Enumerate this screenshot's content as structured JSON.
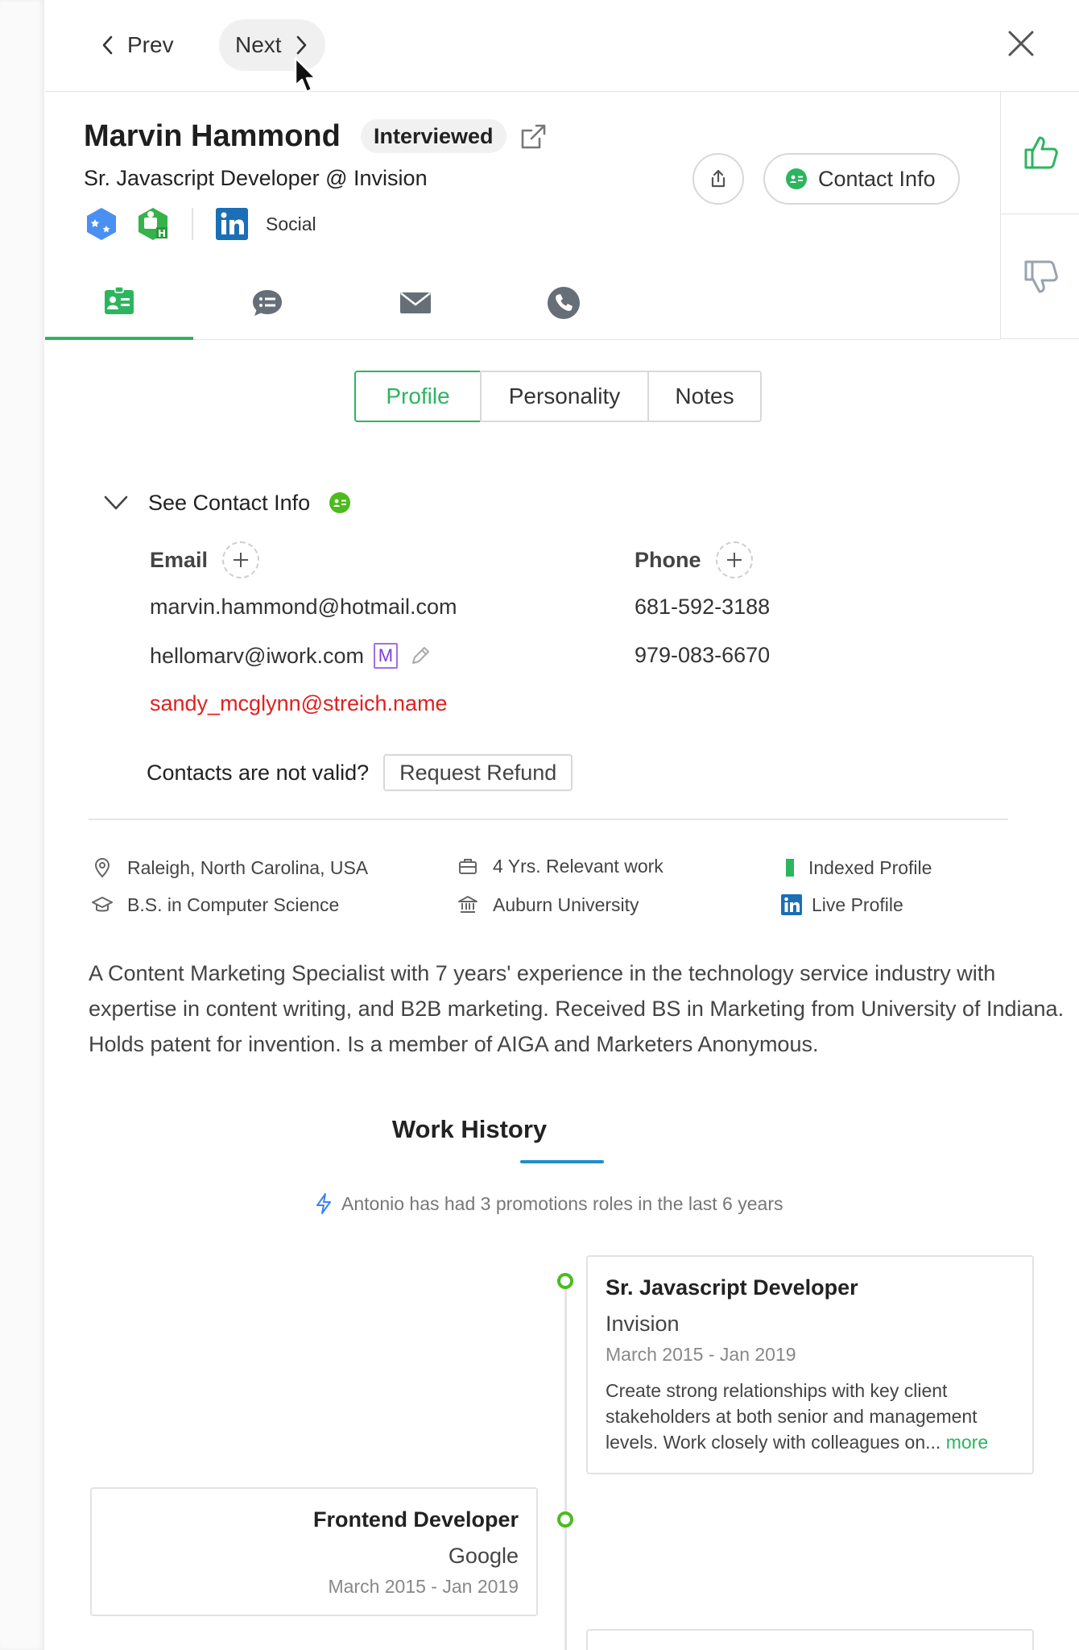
{
  "nav": {
    "prev_label": "Prev",
    "next_label": "Next"
  },
  "candidate": {
    "name": "Marvin Hammond",
    "status": "Interviewed",
    "title_line": "Sr. Javascript Developer  @ Invision",
    "social_label": "Social"
  },
  "actions": {
    "contact_info_label": "Contact Info"
  },
  "icon_tabs": [
    "profile-card-icon",
    "chat-icon",
    "mail-icon",
    "phone-icon"
  ],
  "segmented_tabs": {
    "profile": "Profile",
    "personality": "Personality",
    "notes": "Notes"
  },
  "contact": {
    "toggle_label": "See Contact Info",
    "email_header": "Email",
    "phone_header": "Phone",
    "emails": [
      "marvin.hammond@hotmail.com",
      "hellomarv@iwork.com",
      "sandy_mcglynn@streich.name"
    ],
    "email_badge": "M",
    "phones": [
      "681-592-3188",
      "979-083-6670"
    ],
    "invalid_question": "Contacts are not valid?",
    "refund_label": "Request Refund"
  },
  "facts": {
    "location": "Raleigh, North Carolina, USA",
    "degree": "B.S. in Computer Science",
    "experience": "4 Yrs. Relevant work",
    "school": "Auburn University",
    "indexed": "Indexed Profile",
    "live": "Live Profile"
  },
  "summary": "A Content Marketing Specialist with 7 years' experience in the technology service industry with expertise in content writing, and B2B marketing. Received BS in Marketing from University of Indiana. Holds patent for invention. Is a member of AIGA and Marketers Anonymous.",
  "work_history": {
    "title": "Work History",
    "note": "Antonio has had 3 promotions roles in the last 6 years",
    "jobs": [
      {
        "title": "Sr. Javascript Developer",
        "company": "Invision",
        "dates": "March 2015 - Jan 2019",
        "description": "Create strong relationships with key client stakeholders at both senior and management levels. Work closely with colleagues on...",
        "more": "more"
      },
      {
        "title": "Frontend Developer",
        "company": "Google",
        "dates": "March 2015 - Jan 2019"
      }
    ]
  },
  "colors": {
    "accent_green": "#2cb55f",
    "error_red": "#e02020",
    "link_blue": "#1f8ec9",
    "purple_badge": "#7d3fd8"
  }
}
